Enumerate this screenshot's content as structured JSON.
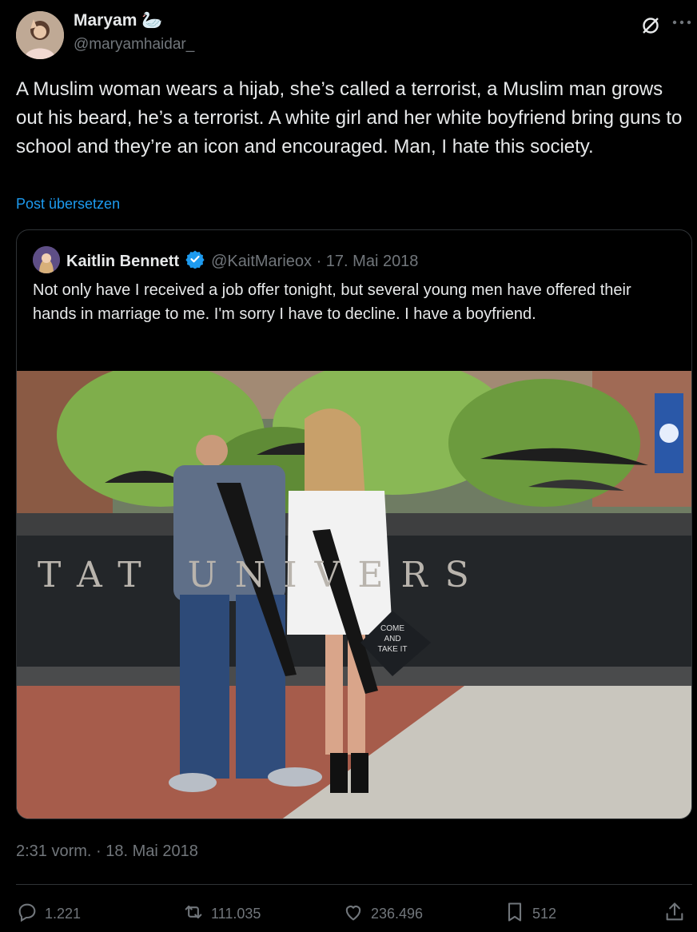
{
  "author": {
    "name": "Maryam",
    "name_emoji": "🦢",
    "handle": "@maryamhaidar_"
  },
  "tweet": {
    "text": "A Muslim woman wears a hijab, she’s called a terrorist, a Muslim man grows out his beard, he’s a terrorist. A white girl and her white boyfriend bring guns to school and they’re an icon and encouraged. Man, I hate this society.",
    "translate_label": "Post übersetzen",
    "timestamp": "2:31 vorm. · 18. Mai 2018"
  },
  "quote": {
    "name": "Kaitlin Bennett",
    "verified": true,
    "meta": "@KaitMarieox · 17. Mai 2018",
    "text": "Not only have I received a job offer tonight, but several young men have offered their hands in marriage to me. I'm sorry I have to decline. I have a boyfriend.",
    "photo": {
      "sign_text": "TAT UNIVERS",
      "cap_text": "COME AND TAKE IT"
    }
  },
  "actions": {
    "replies": "1.221",
    "reposts": "111.035",
    "likes": "236.496",
    "bookmarks": "512"
  },
  "colors": {
    "background": "#000000",
    "text": "#e7e9ea",
    "muted": "#71767b",
    "link": "#1d9bf0",
    "border": "#2f3336",
    "verified": "#1d9bf0"
  }
}
